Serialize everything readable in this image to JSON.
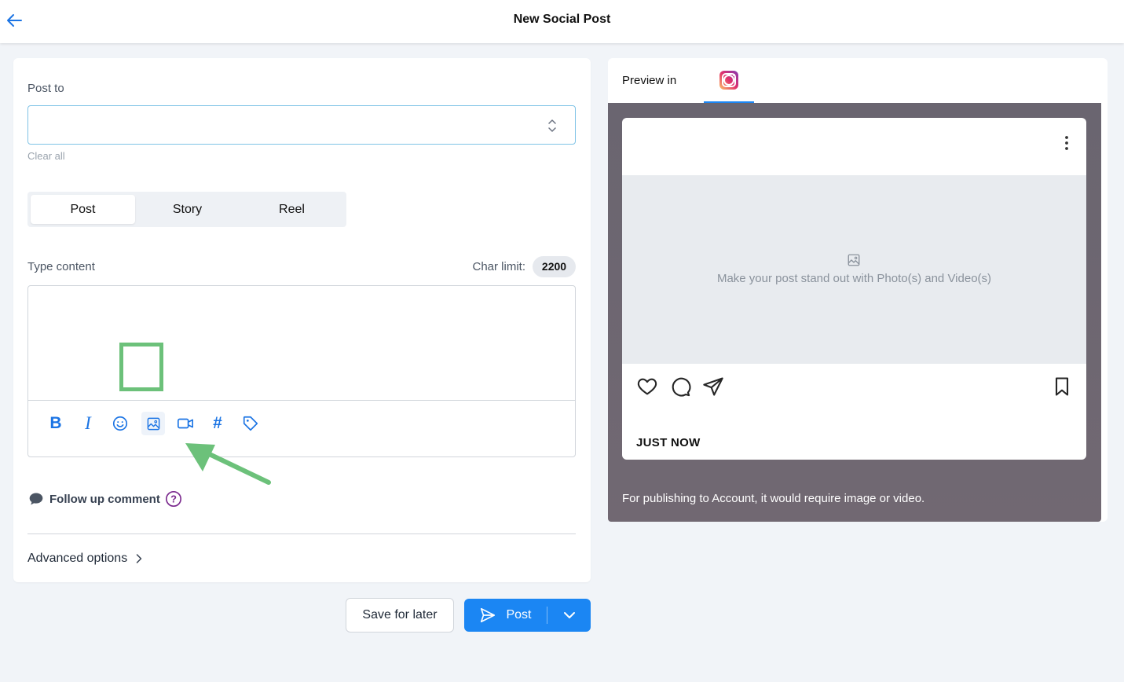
{
  "header": {
    "title": "New Social Post"
  },
  "post_to": {
    "label": "Post to",
    "value": "",
    "clear_label": "Clear all"
  },
  "post_types": [
    "Post",
    "Story",
    "Reel"
  ],
  "content": {
    "label": "Type content",
    "char_limit_label": "Char limit:",
    "char_limit_value": "2200",
    "value": ""
  },
  "toolbar_icons": [
    "bold-icon",
    "italic-icon",
    "emoji-icon",
    "image-icon",
    "video-icon",
    "hashtag-icon",
    "tag-icon"
  ],
  "follow_up": {
    "label": "Follow up comment"
  },
  "advanced": {
    "label": "Advanced options"
  },
  "actions": {
    "save_label": "Save for later",
    "post_label": "Post"
  },
  "preview": {
    "label": "Preview in",
    "network": "instagram-icon",
    "media_placeholder": "Make your post stand out with Photo(s) and Video(s)",
    "timestamp": "JUST NOW",
    "note": "For publishing to Account, it would require image or video."
  },
  "colors": {
    "accent": "#1b86f3",
    "annotation": "#6cc17a",
    "help": "#7b2a8e"
  }
}
